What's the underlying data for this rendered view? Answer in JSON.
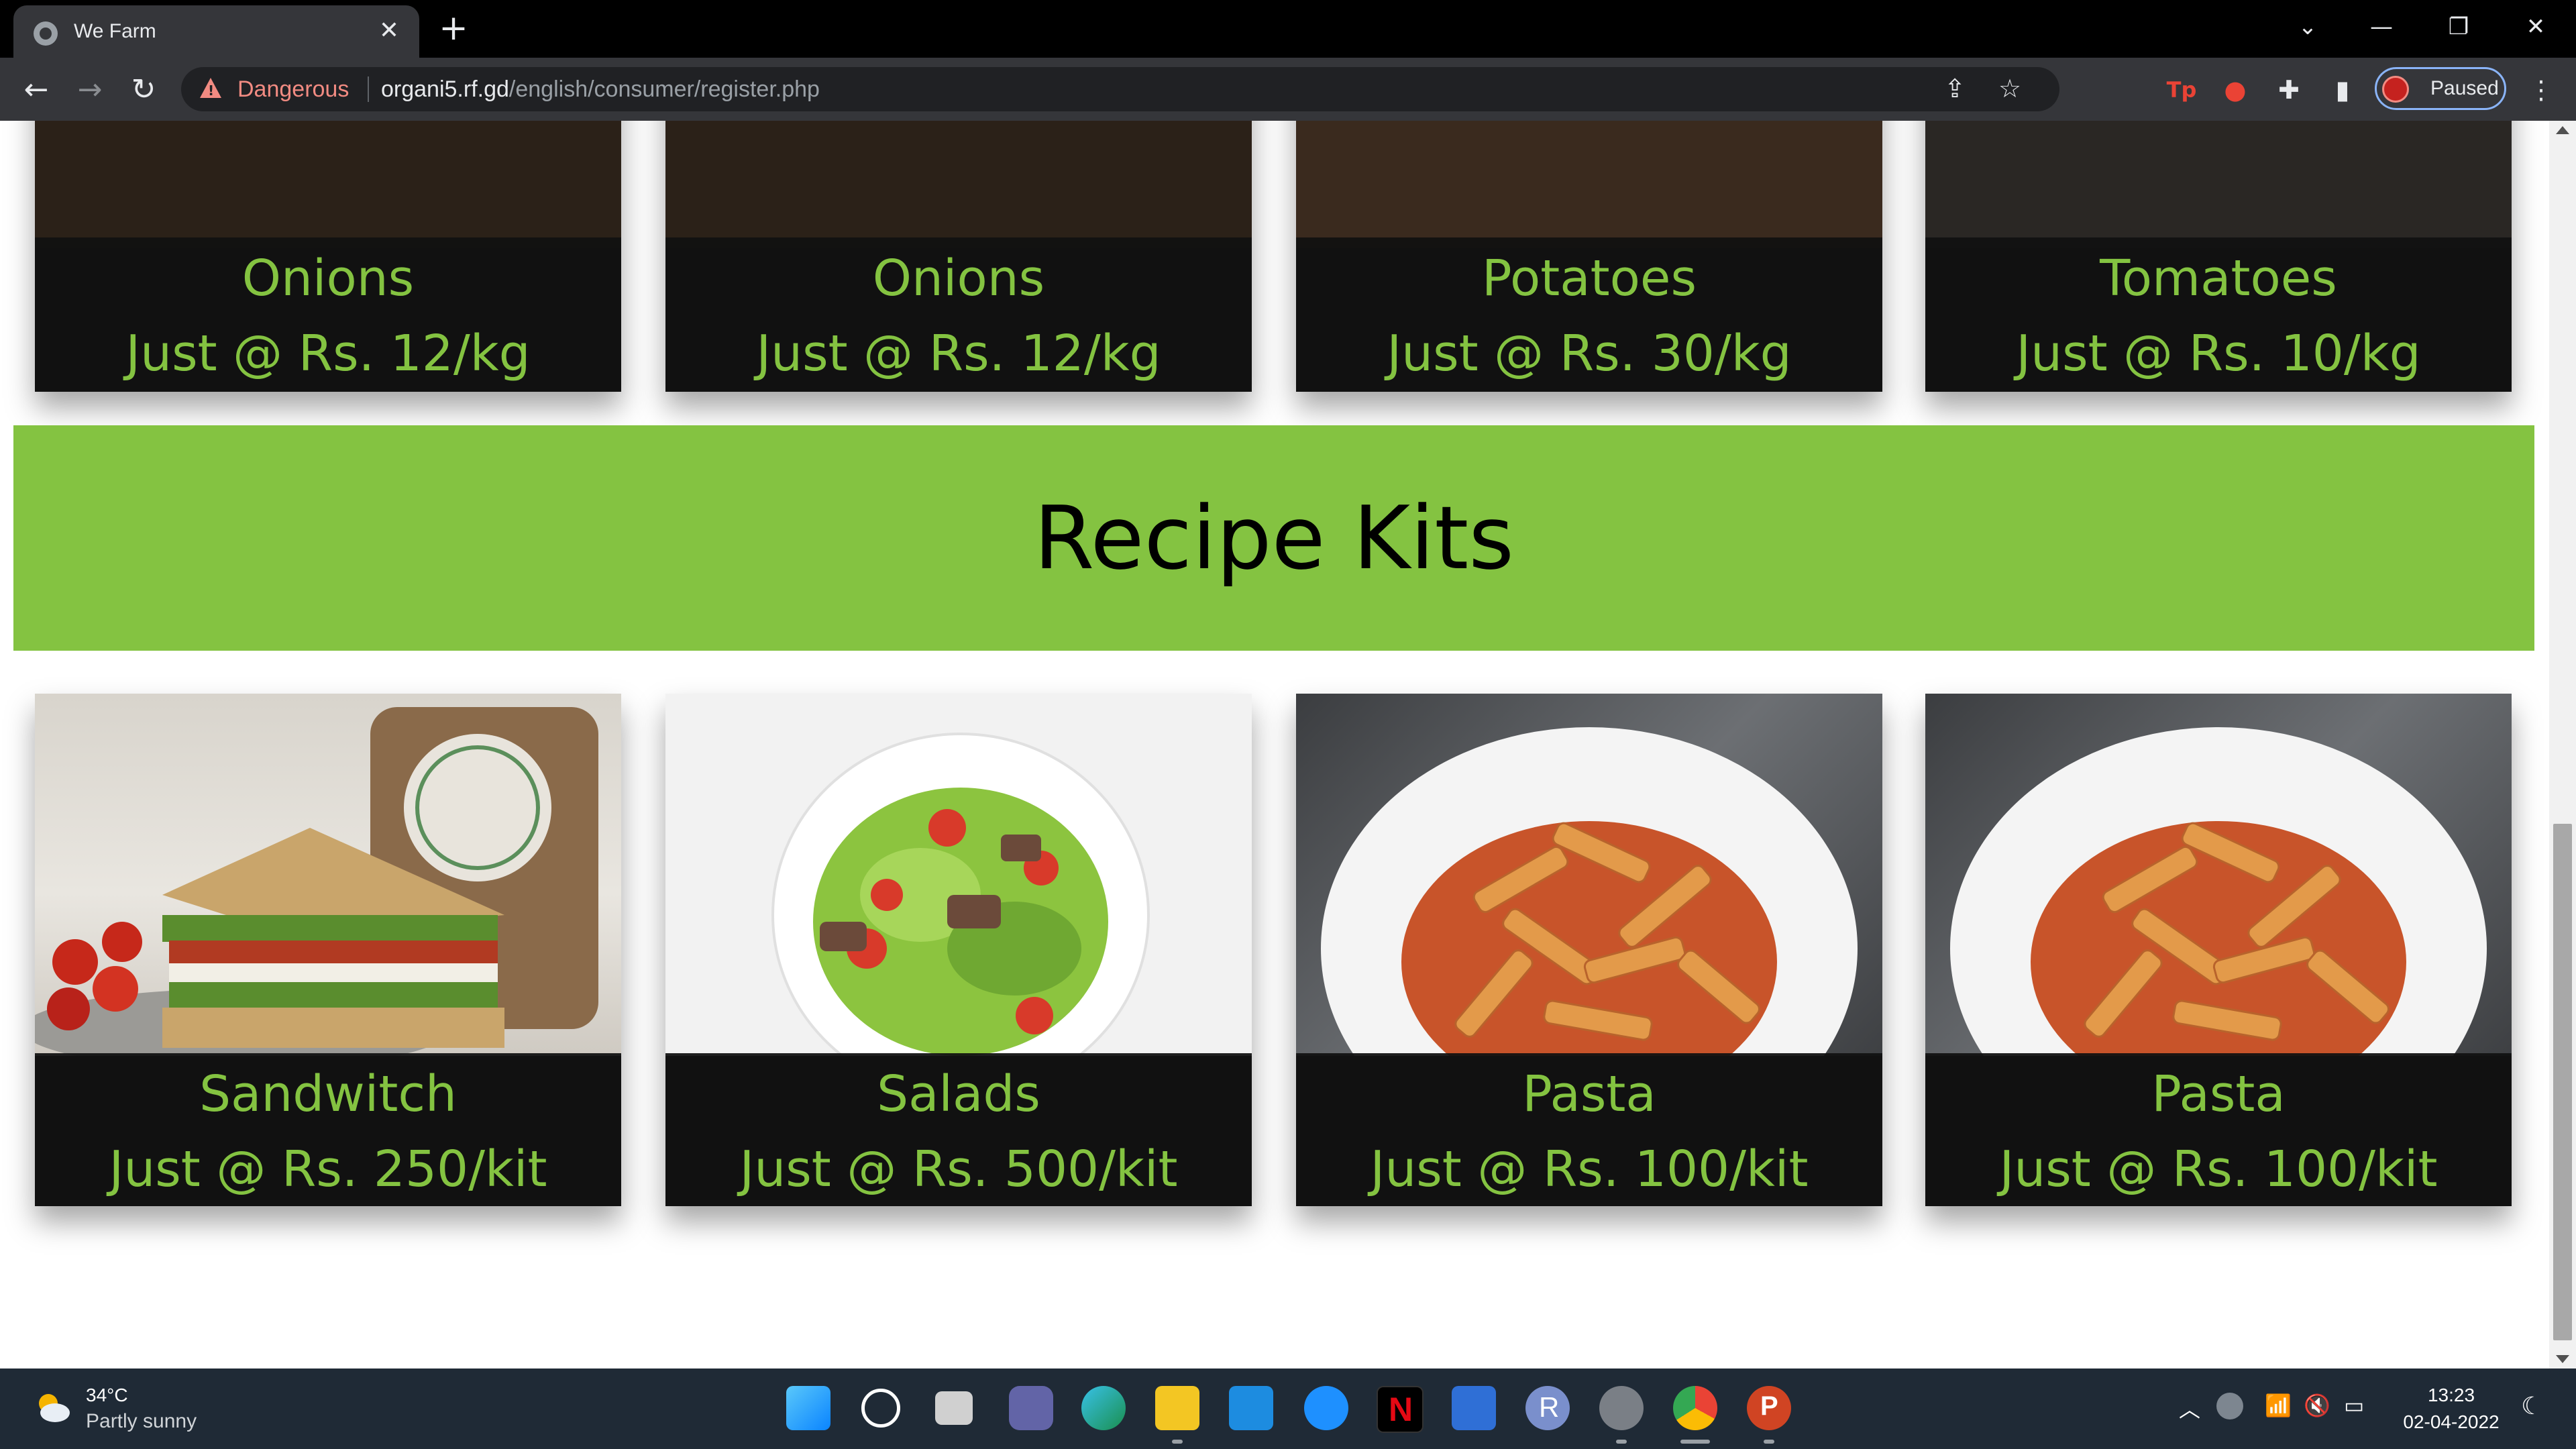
{
  "browser": {
    "tab_title": "We Farm",
    "tab_close": "✕",
    "new_tab": "+",
    "security_label": "Dangerous",
    "url_host": "organi5.rf.gd",
    "url_path": "/english/consumer/register.php",
    "profile_label": "Paused",
    "window_controls": {
      "chevron": "⌄",
      "minimize": "—",
      "restore": "❐",
      "close": "✕"
    },
    "nav": {
      "back": "←",
      "forward": "→",
      "reload": "↻"
    },
    "toolbar_icons": {
      "share": "⇪",
      "star": "☆",
      "tp": "Tp",
      "ext_red": "●",
      "puzzle": "✚",
      "sidebar": "▮",
      "menu": "⋮"
    }
  },
  "products_top": [
    {
      "name": "Onions",
      "price": "Just @ Rs. 12/kg"
    },
    {
      "name": "Onions",
      "price": "Just @ Rs. 12/kg"
    },
    {
      "name": "Potatoes",
      "price": "Just @ Rs. 30/kg"
    },
    {
      "name": "Tomatoes",
      "price": "Just @ Rs. 10/kg"
    }
  ],
  "recipe_section": {
    "title": "Recipe Kits"
  },
  "recipe_kits": [
    {
      "name": "Sandwitch",
      "price": "Just @ Rs. 250/kit"
    },
    {
      "name": "Salads",
      "price": "Just @ Rs. 500/kit"
    },
    {
      "name": "Pasta",
      "price": "Just @ Rs. 100/kit"
    },
    {
      "name": "Pasta",
      "price": "Just @ Rs. 100/kit"
    }
  ],
  "colors": {
    "accent_green": "#84c341",
    "caption_bg": "#111111",
    "danger_red": "#f28b82"
  },
  "taskbar": {
    "weather_temp": "34°C",
    "weather_desc": "Partly sunny",
    "apps": [
      "start-icon",
      "search-icon",
      "task-view-icon",
      "teams-icon",
      "edge-icon",
      "file-explorer-icon",
      "mail-icon",
      "safari-icon",
      "netflix-icon",
      "network-app-icon",
      "r-icon",
      "settings-icon",
      "chrome-icon",
      "powerpoint-icon"
    ],
    "tray": {
      "chevron": "︿",
      "wifi": "📶",
      "volume": "🔇",
      "battery": "▭"
    },
    "time": "13:23",
    "date": "02-04-2022"
  }
}
